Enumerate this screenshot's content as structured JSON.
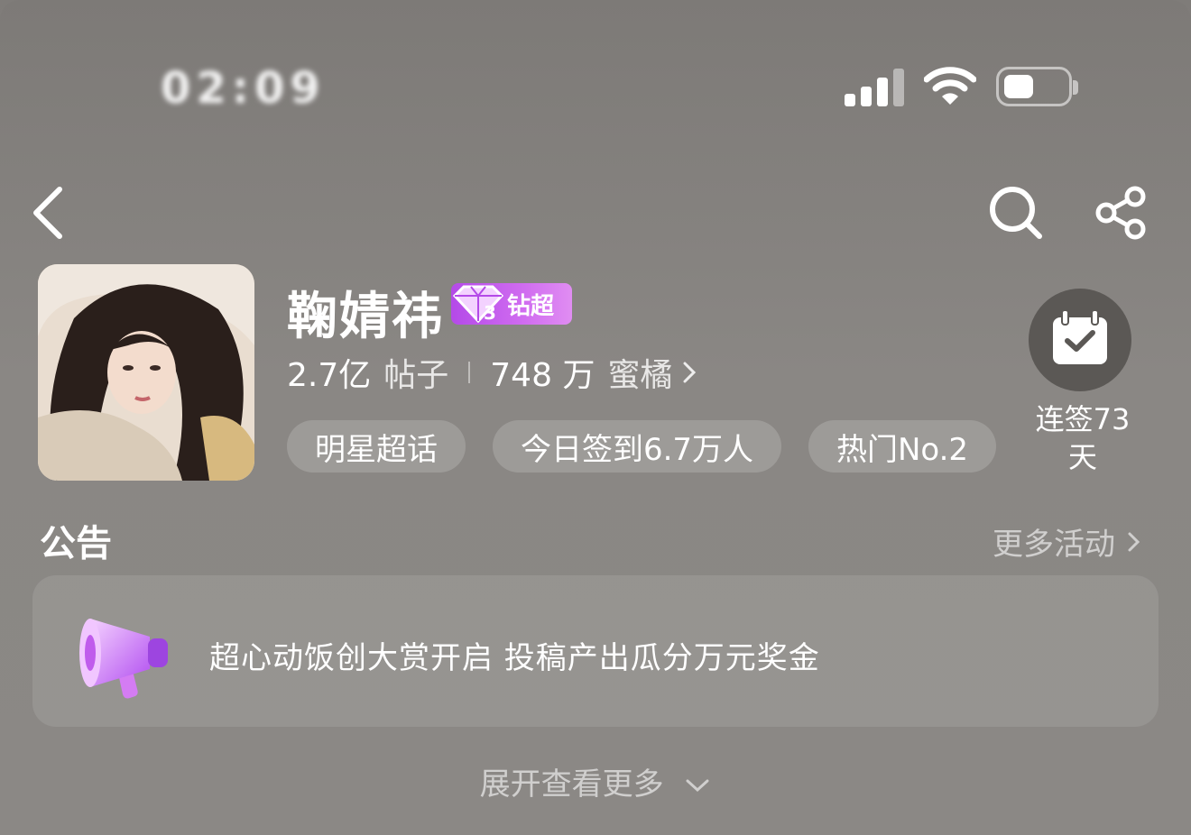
{
  "status_bar": {
    "time": "02:09"
  },
  "profile": {
    "name": "鞠婧祎",
    "badge_label": "钻超",
    "posts_count": "2.7亿",
    "posts_unit": "帖子",
    "fans_count": "748 万",
    "fans_unit": "蜜橘",
    "tags": [
      "明星超话",
      "今日签到6.7万人",
      "热门No.2"
    ],
    "checkin_line1": "连签73",
    "checkin_line2": "天"
  },
  "announcement": {
    "title": "公告",
    "more_label": "更多活动",
    "text": "超心动饭创大赏开启 投稿产出瓜分万元奖金",
    "expand_label": "展开查看更多"
  },
  "colors": {
    "background": "#8a8784",
    "badge": "#c05cec"
  }
}
